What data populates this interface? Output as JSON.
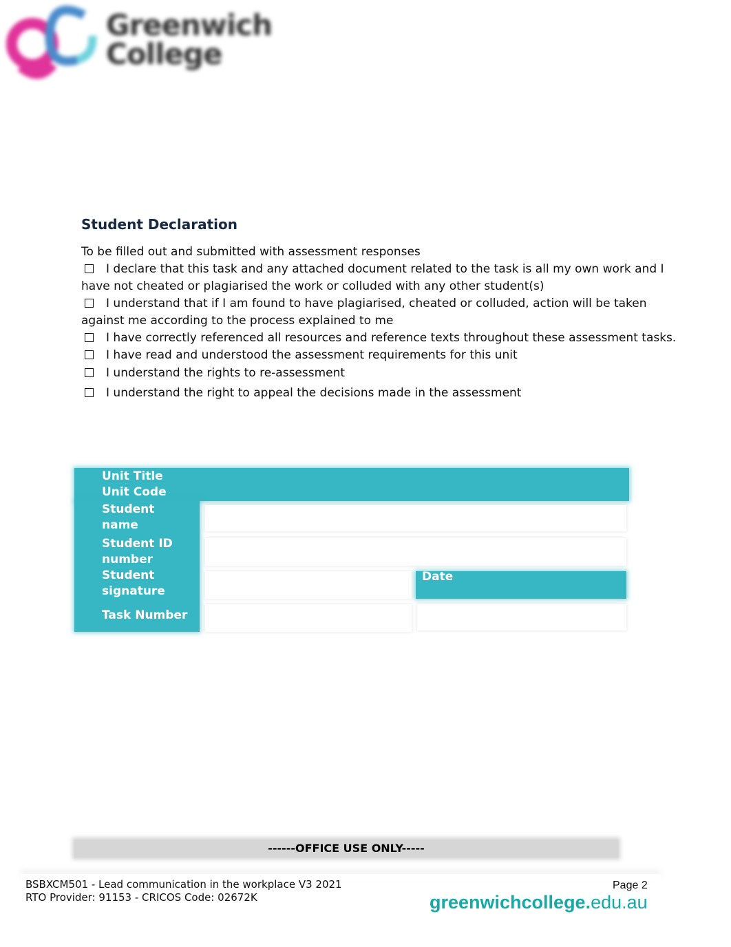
{
  "logo": {
    "line1": "Greenwich",
    "line2": "College",
    "colors": {
      "pink": "#e0349a",
      "blue": "#4a8ccc",
      "cyan": "#6fd2dd",
      "text": "#333333"
    }
  },
  "declaration": {
    "heading": "Student Declaration",
    "intro": "To be filled out and submitted with assessment responses",
    "items": [
      {
        "checked": false,
        "text": "I declare that this task and any attached document related to the task is all my own work and I have not cheated or plagiarised the work or colluded with any other student(s)"
      },
      {
        "checked": false,
        "text": "I understand that if I am found to have plagiarised, cheated or colluded, action will be taken against me according to the process explained to me"
      },
      {
        "checked": false,
        "text": "I have correctly referenced all resources and reference texts throughout these assessment tasks."
      },
      {
        "checked": false,
        "text": "I have read and understood the assessment requirements for this unit"
      },
      {
        "checked": false,
        "text": "I understand the rights to re-assessment"
      },
      {
        "checked": false,
        "text": "I understand the right to appeal the decisions made in the assessment"
      }
    ]
  },
  "form": {
    "accent": "#37b6c3",
    "unit_title_label": "Unit Title",
    "unit_code_label": "Unit Code",
    "student_name_label_1": "Student",
    "student_name_label_2": "name",
    "student_id_label_1": "Student ID",
    "student_id_label_2": "number",
    "student_signature_label_1": "Student",
    "student_signature_label_2": "signature",
    "date_label": "Date",
    "task_number_label": "Task Number",
    "values": {
      "student_name": "",
      "student_id": "",
      "student_signature": "",
      "task_number": "",
      "date": ""
    }
  },
  "office_use": "------OFFICE USE ONLY-----",
  "footer": {
    "line1": "BSBXCM501 - Lead communication in the workplace V3 2021",
    "line2": "RTO Provider: 91153  - CRICOS  Code: 02672K",
    "page": "Page 2",
    "site_bold": "greenwichcollege.",
    "site_rest": "edu.au",
    "site_color": "#17a9a8"
  }
}
